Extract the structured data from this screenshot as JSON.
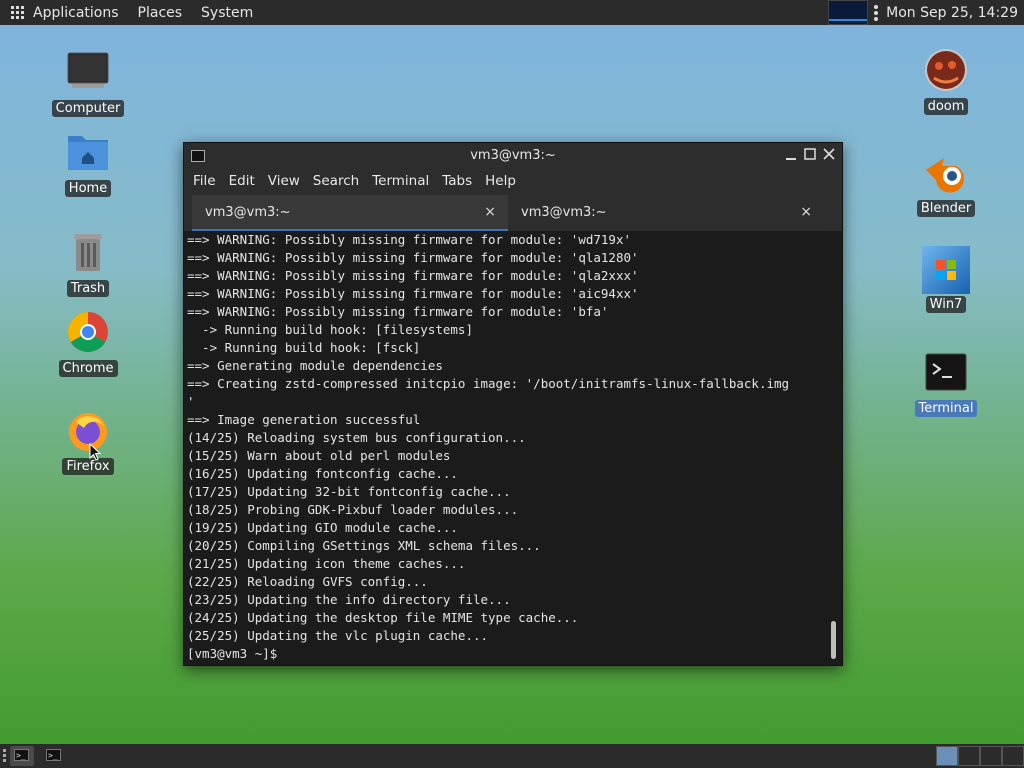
{
  "top_panel": {
    "menus": [
      "Applications",
      "Places",
      "System"
    ],
    "clock": "Mon Sep 25, 14:29"
  },
  "desktop_left": [
    {
      "label": "Computer",
      "icon": "computer-icon"
    },
    {
      "label": "Home",
      "icon": "home-folder-icon"
    },
    {
      "label": "Trash",
      "icon": "trash-icon"
    },
    {
      "label": "Chrome",
      "icon": "chrome-icon"
    },
    {
      "label": "Firefox",
      "icon": "firefox-icon"
    }
  ],
  "desktop_right": [
    {
      "label": "doom",
      "icon": "doom-icon"
    },
    {
      "label": "Blender",
      "icon": "blender-icon"
    },
    {
      "label": "Win7",
      "icon": "win7-icon"
    },
    {
      "label": "Terminal",
      "icon": "terminal-icon"
    }
  ],
  "window": {
    "title": "vm3@vm3:~",
    "menu": [
      "File",
      "Edit",
      "View",
      "Search",
      "Terminal",
      "Tabs",
      "Help"
    ],
    "tabs": [
      {
        "label": "vm3@vm3:~",
        "active": true
      },
      {
        "label": "vm3@vm3:~",
        "active": false
      }
    ],
    "close_glyph": "×"
  },
  "terminal_lines": [
    "==> WARNING: Possibly missing firmware for module: 'wd719x'",
    "==> WARNING: Possibly missing firmware for module: 'qla1280'",
    "==> WARNING: Possibly missing firmware for module: 'qla2xxx'",
    "==> WARNING: Possibly missing firmware for module: 'aic94xx'",
    "==> WARNING: Possibly missing firmware for module: 'bfa'",
    "  -> Running build hook: [filesystems]",
    "  -> Running build hook: [fsck]",
    "==> Generating module dependencies",
    "==> Creating zstd-compressed initcpio image: '/boot/initramfs-linux-fallback.img",
    "'",
    "==> Image generation successful",
    "(14/25) Reloading system bus configuration...",
    "(15/25) Warn about old perl modules",
    "(16/25) Updating fontconfig cache...",
    "(17/25) Updating 32-bit fontconfig cache...",
    "(18/25) Probing GDK-Pixbuf loader modules...",
    "(19/25) Updating GIO module cache...",
    "(20/25) Compiling GSettings XML schema files...",
    "(21/25) Updating icon theme caches...",
    "(22/25) Reloading GVFS config...",
    "(23/25) Updating the info directory file...",
    "(24/25) Updating the desktop file MIME type cache...",
    "(25/25) Updating the vlc plugin cache...",
    "[vm3@vm3 ~]$ "
  ],
  "bottom_panel": {
    "task_glyph": ">_"
  },
  "colors": {
    "panel": "#2b2b2b",
    "terminal_bg": "#1b1b1b",
    "tab_accent": "#3d72b8",
    "selected_label": "#4a78b8"
  }
}
